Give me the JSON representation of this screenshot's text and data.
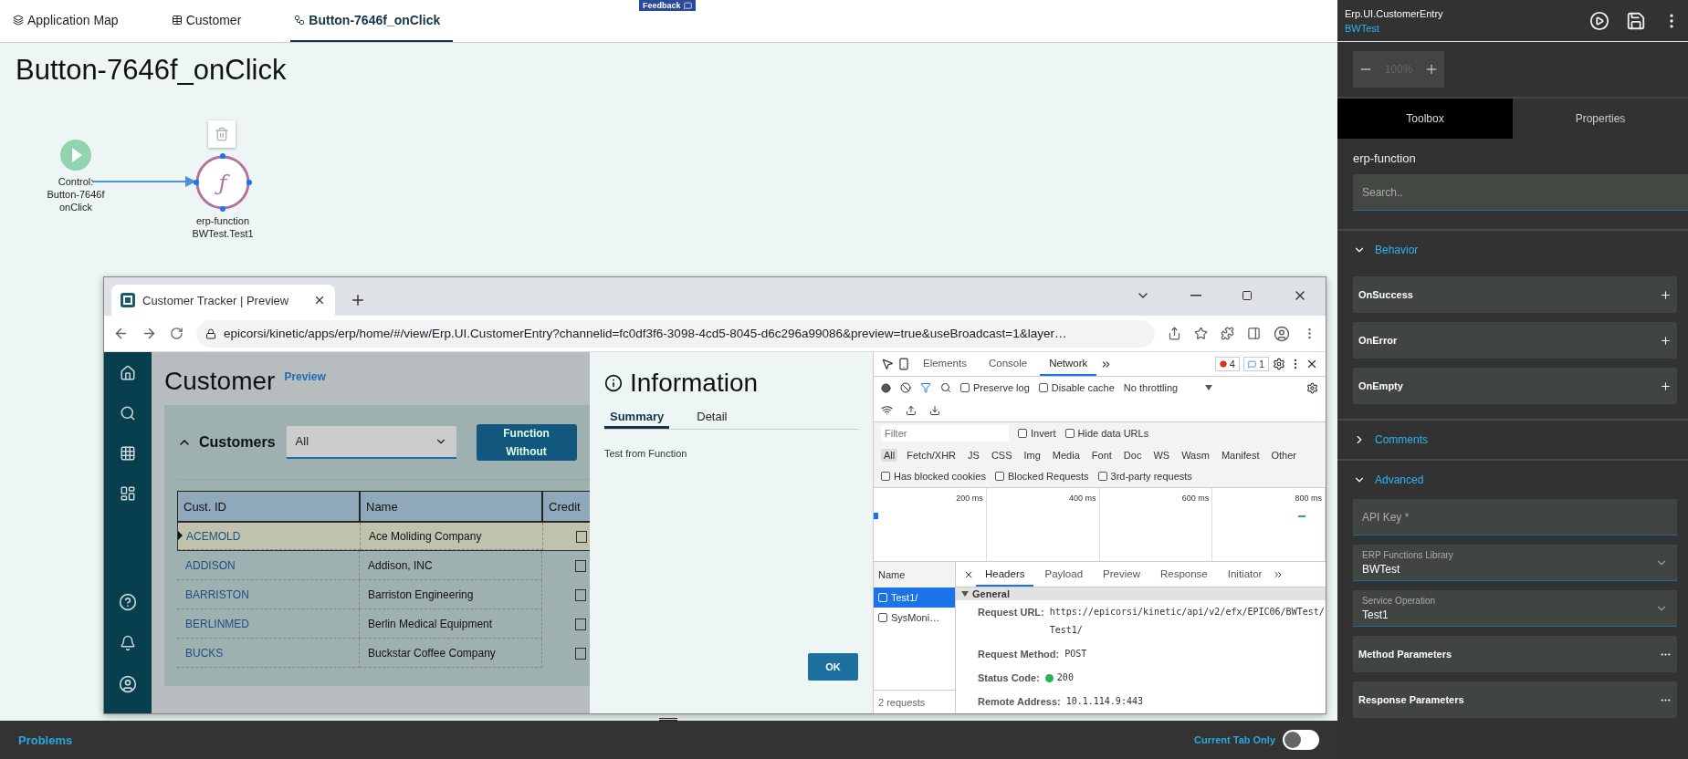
{
  "tabs": [
    {
      "kind": "map",
      "label": "Application Map",
      "selected": false
    },
    {
      "kind": "page",
      "label": "Customer",
      "selected": false
    },
    {
      "kind": "flow",
      "label": "Button-7646f_onClick",
      "selected": true
    }
  ],
  "feedback": "Feedback",
  "canvas": {
    "title": "Button-7646f_onClick",
    "nodes": [
      {
        "kind": "trigger",
        "lines": [
          "Control:",
          "Button-7646f",
          "onClick"
        ],
        "selected": false
      },
      {
        "kind": "function",
        "symbol": "ƒ",
        "lines": [
          "erp-function",
          "BWTest.Test1"
        ],
        "selected": true
      }
    ]
  },
  "preview": {
    "tab_title": "Customer Tracker | Preview",
    "url": "epicorsi/kinetic/apps/erp/home/#/view/Erp.UI.CustomerEntry?channelid=fc0df3f6-3098-4cd5-8045-d6c296a99086&preview=true&useBroadcast=1&layer…",
    "app": {
      "title": "Customer",
      "badge": "Preview",
      "panel": "Customers",
      "filter": "All",
      "button_lines": [
        "Function",
        "Without"
      ],
      "columns": [
        "Cust. ID",
        "Name",
        "Credit"
      ],
      "rows": [
        {
          "id": "ACEMOLD",
          "name": "Ace Moliding Company",
          "checked": false,
          "selected": true
        },
        {
          "id": "ADDISON",
          "name": "Addison, INC",
          "checked": false,
          "selected": false
        },
        {
          "id": "BARRISTON",
          "name": "Barriston Engineering",
          "checked": false,
          "selected": false
        },
        {
          "id": "BERLINMED",
          "name": "Berlin Medical Equipment",
          "checked": false,
          "selected": false
        },
        {
          "id": "BUCKS",
          "name": "Buckstar Coffee Company",
          "checked": false,
          "selected": false
        }
      ]
    },
    "info": {
      "title": "Information",
      "tabs": [
        {
          "label": "Summary",
          "selected": true
        },
        {
          "label": "Detail",
          "selected": false
        }
      ],
      "message": "Test from Function",
      "ok": "OK"
    },
    "devtools": {
      "tabs": [
        {
          "label": "Elements",
          "selected": false
        },
        {
          "label": "Console",
          "selected": false
        },
        {
          "label": "Network",
          "selected": true
        }
      ],
      "errors": "4",
      "messages": "1",
      "toolbar_checks": [
        {
          "label": "Preserve log",
          "checked": false
        },
        {
          "label": "Disable cache",
          "checked": false
        }
      ],
      "throttling": "No throttling",
      "filter_placeholder": "Filter",
      "filter_checks": [
        {
          "label": "Invert",
          "checked": false
        },
        {
          "label": "Hide data URLs",
          "checked": false
        }
      ],
      "types": [
        {
          "label": "All",
          "selected": true
        },
        {
          "label": "Fetch/XHR",
          "selected": false
        },
        {
          "label": "JS",
          "selected": false
        },
        {
          "label": "CSS",
          "selected": false
        },
        {
          "label": "Img",
          "selected": false
        },
        {
          "label": "Media",
          "selected": false
        },
        {
          "label": "Font",
          "selected": false
        },
        {
          "label": "Doc",
          "selected": false
        },
        {
          "label": "WS",
          "selected": false
        },
        {
          "label": "Wasm",
          "selected": false
        },
        {
          "label": "Manifest",
          "selected": false
        },
        {
          "label": "Other",
          "selected": false
        }
      ],
      "blocked_checks": [
        {
          "label": "Has blocked cookies",
          "checked": false
        },
        {
          "label": "Blocked Requests",
          "checked": false
        },
        {
          "label": "3rd-party requests",
          "checked": false
        }
      ],
      "ticks": [
        "200 ms",
        "400 ms",
        "600 ms",
        "800 ms"
      ],
      "name_header": "Name",
      "requests": [
        {
          "name": "Test1/",
          "selected": true
        },
        {
          "name": "SysMoni…",
          "selected": false
        }
      ],
      "request_count": "2 requests",
      "detail_tabs": [
        {
          "label": "Headers",
          "selected": true
        },
        {
          "label": "Payload",
          "selected": false
        },
        {
          "label": "Preview",
          "selected": false
        },
        {
          "label": "Response",
          "selected": false
        },
        {
          "label": "Initiator",
          "selected": false
        }
      ],
      "section": "General",
      "headers": [
        {
          "kind": "text",
          "name": "Request URL:",
          "value": "https://epicorsi/kinetic/api/v2/efx/EPIC06/BWTest/Test1/"
        },
        {
          "kind": "text",
          "name": "Request Method:",
          "value": "POST"
        },
        {
          "kind": "status",
          "name": "Status Code:",
          "value": "200"
        },
        {
          "kind": "text",
          "name": "Remote Address:",
          "value": "10.1.114.9:443"
        }
      ]
    }
  },
  "panel": {
    "title": "Erp.UI.CustomerEntry",
    "subtitle": "BWTest",
    "zoom": "100%",
    "tabs": [
      {
        "label": "Toolbox",
        "selected": true
      },
      {
        "label": "Properties",
        "selected": false
      }
    ],
    "heading": "erp-function",
    "search_placeholder": "Search..",
    "sections": [
      {
        "label": "Behavior",
        "expanded": true,
        "items": [
          {
            "kind": "event",
            "label": "OnSuccess"
          },
          {
            "kind": "event",
            "label": "OnError"
          },
          {
            "kind": "event",
            "label": "OnEmpty"
          }
        ]
      },
      {
        "label": "Comments",
        "expanded": false
      },
      {
        "label": "Advanced",
        "expanded": true,
        "items": [
          {
            "kind": "input",
            "placeholder": "API Key *"
          },
          {
            "kind": "select",
            "label": "ERP Functions Library",
            "value": "BWTest"
          },
          {
            "kind": "select",
            "label": "Service Operation",
            "value": "Test1"
          },
          {
            "kind": "params",
            "label": "Method Parameters"
          },
          {
            "kind": "params",
            "label": "Response Parameters"
          }
        ]
      }
    ]
  },
  "bottom": {
    "label": "Problems",
    "toggle_label": "Current Tab Only",
    "toggle_on": false
  }
}
